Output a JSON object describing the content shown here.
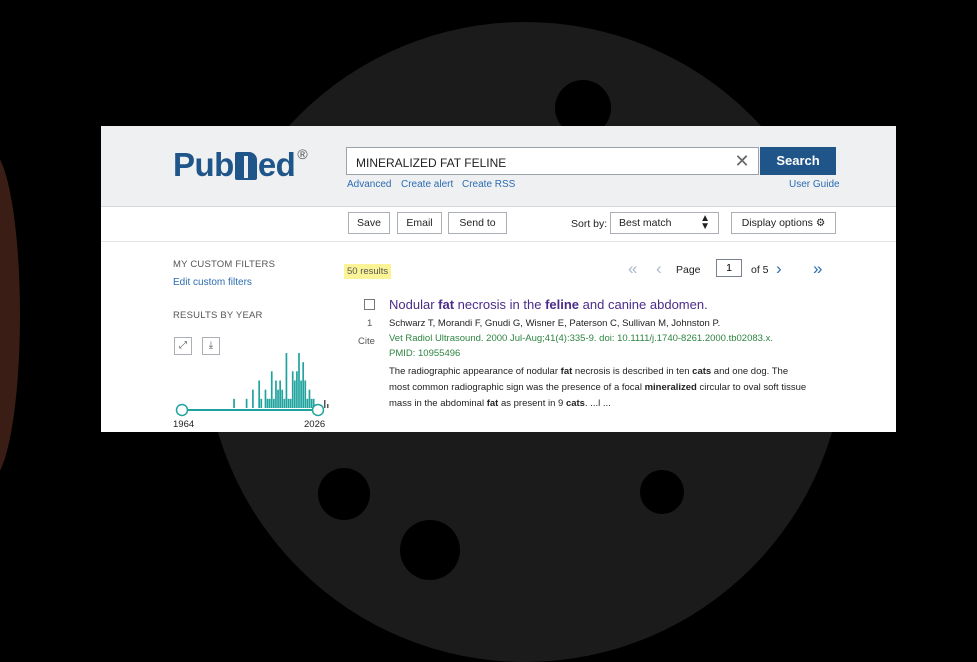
{
  "brand": {
    "name_pre": "Pub",
    "name_post": "ed",
    "reg": "®"
  },
  "search": {
    "query": "MINERALIZED FAT FELINE",
    "clear_label": "✕",
    "button_label": "Search",
    "links": [
      "Advanced",
      "Create alert",
      "Create RSS"
    ],
    "user_guide": "User Guide"
  },
  "toolbar": {
    "save": "Save",
    "email": "Email",
    "send_to": "Send to",
    "sort_label": "Sort by:",
    "sort_value": "Best match",
    "display_options": "Display options ⚙"
  },
  "sidebar": {
    "filters_heading": "MY CUSTOM FILTERS",
    "edit_filters": "Edit custom filters",
    "results_by_year": "RESULTS BY YEAR",
    "expand_icon": "expand-icon",
    "download_icon": "download-icon",
    "year_start": "1964",
    "year_end": "2026"
  },
  "results": {
    "count": "50 results",
    "page_label": "Page",
    "page_value": "1",
    "of_pages": "of 5"
  },
  "article": {
    "number": "1",
    "cite": "Cite",
    "title_parts": [
      "Nodular ",
      "fat",
      " necrosis in the ",
      "feline",
      " and canine abdomen."
    ],
    "authors": "Schwarz T, Morandi F, Gnudi G, Wisner E, Paterson C, Sullivan M, Johnston P.",
    "citation": "Vet Radiol Ultrasound. 2000 Jul-Aug;41(4):335-9. doi: 10.1111/j.1740-8261.2000.tb02083.x.",
    "pmid": "PMID: 10955496",
    "snippet_line1": [
      "The radiographic appearance of nodular ",
      "fat",
      " necrosis is described in ten ",
      "cats",
      " and one dog. The"
    ],
    "snippet_line2": [
      "most common radiographic sign was the presence of a focal ",
      "mineralized",
      " circular to oval soft tissue"
    ],
    "snippet_line3": [
      "mass in the abdominal ",
      "fat",
      " as present in 9 ",
      "cats",
      ". ...l ..."
    ]
  },
  "histogram": {
    "bars": [
      0,
      0,
      0,
      0,
      0,
      0,
      0,
      0,
      0,
      0,
      0,
      0,
      0,
      0,
      0,
      0,
      0,
      0,
      0,
      0,
      0,
      0,
      0,
      1,
      0,
      0,
      0,
      0,
      0,
      1,
      0,
      0,
      2,
      0,
      0,
      3,
      1,
      0,
      2,
      1,
      1,
      4,
      1,
      3,
      2,
      3,
      2,
      1,
      6,
      1,
      1,
      4,
      3,
      4,
      6,
      3,
      5,
      3,
      1,
      2,
      1,
      1,
      0
    ]
  },
  "colors": {
    "brand": "#20558a",
    "link": "#2c6cb0",
    "title": "#4b2c8a",
    "citation": "#2e8540",
    "bar": "#20a39e",
    "highlight": "#fbf496"
  }
}
